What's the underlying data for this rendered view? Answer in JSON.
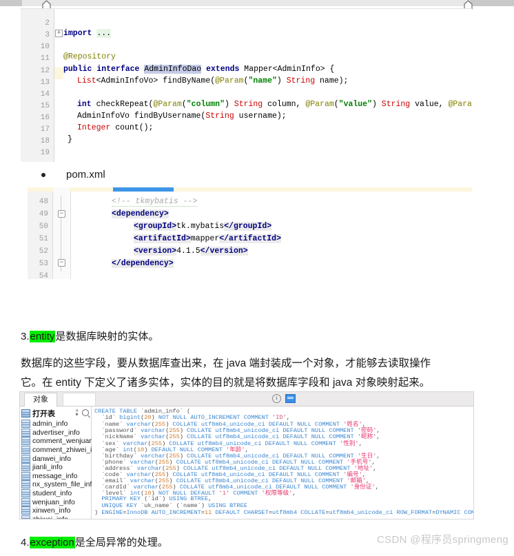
{
  "topbar": {
    "scroll_marker_icon": "home-marker-icon",
    "scroll_marker_icon_2": "home-marker-icon"
  },
  "java_code": {
    "line_numbers": [
      "2",
      "3",
      "10",
      "11",
      "12",
      "13",
      "14",
      "15",
      "16",
      "17",
      "18",
      "19"
    ],
    "lines": [
      "",
      "import ...",
      "",
      "@Repository",
      "public interface AdminInfoDao extends Mapper<AdminInfo> {",
      "    List<AdminInfoVo> findByName(@Param(\"name\") String name);",
      "",
      "    int checkRepeat(@Param(\"column\") String column, @Param(\"value\") String value, @Param(\"id\") Long id);",
      "    AdminInfoVo findByUsername(String username);",
      "    Integer count();",
      "}",
      ""
    ],
    "selected_token": "AdminInfoDao",
    "fold_icon": "fold-expand-icon"
  },
  "bullet": {
    "label": "pom.xml",
    "marker_icon": "bullet-dot-icon"
  },
  "pom_code": {
    "line_numbers": [
      "48",
      "49",
      "50",
      "51",
      "52",
      "53",
      "54"
    ],
    "lines": [
      "            <!-- tkmybatis -->",
      "            <dependency>",
      "                <groupId>tk.mybatis</groupId>",
      "                <artifactId>mapper</artifactId>",
      "                <version>4.1.5</version>",
      "            </dependency>",
      ""
    ],
    "comment_text": "<!-- tkmybatis -->",
    "groupId_value": "tk.mybatis",
    "artifactId_value": "mapper",
    "version_value": "4.1.5",
    "fold_icon_collapse": "fold-collapse-icon"
  },
  "paragraphs": {
    "heading3_prefix": "3.",
    "heading3_highlight": "entity",
    "heading3_rest": "是数据库映射的实体。",
    "body_line1": "数据库的这些字段，要从数据库查出来，在 java 端封装成一个对象，才能够去读取操作",
    "body_line2": "它。在 entity 下定义了诸多实体，实体的目的就是将数据库字段和 java 对象映射起来。",
    "heading4_prefix": "4.",
    "heading4_highlight": "exception",
    "heading4_rest": "是全局异常的处理。"
  },
  "db_panel": {
    "tab_label": "对象",
    "sidebar_title": "打开表",
    "sidebar_title_icon": "table-icon",
    "search_icon": "search-icon",
    "chevron_icon": "chevron-double-icon",
    "info_icon": "info-icon",
    "view_icon": "view-toggle-icon",
    "tables": [
      "admin_info",
      "advertiser_info",
      "comment_wenjuan_info",
      "comment_zhiwei_info",
      "danwei_info",
      "jianli_info",
      "message_info",
      "nx_system_file_info",
      "student_info",
      "wenjuan_info",
      "xinwen_info",
      "zhiwei_info"
    ],
    "sql_lines": [
      "CREATE TABLE `admin_info` (",
      "  `id` bigint(20) NOT NULL AUTO_INCREMENT COMMENT 'ID',",
      "  `name` varchar(255) COLLATE utf8mb4_unicode_ci DEFAULT NULL COMMENT '姓名',",
      "  `password` varchar(255) COLLATE utf8mb4_unicode_ci DEFAULT NULL COMMENT '密码',",
      "  `nickName` varchar(255) COLLATE utf8mb4_unicode_ci DEFAULT NULL COMMENT '昵称',",
      "  `sex` varchar(255) COLLATE utf8mb4_unicode_ci DEFAULT NULL COMMENT '性别',",
      "  `age` int(10) DEFAULT NULL COMMENT '年龄',",
      "  `birthday` varchar(255) COLLATE utf8mb4_unicode_ci DEFAULT NULL COMMENT '生日',",
      "  `phone` varchar(255) COLLATE utf8mb4_unicode_ci DEFAULT NULL COMMENT '手机号',",
      "  `address` varchar(255) COLLATE utf8mb4_unicode_ci DEFAULT NULL COMMENT '地址',",
      "  `code` varchar(255) COLLATE utf8mb4_unicode_ci DEFAULT NULL COMMENT '编号',",
      "  `email` varchar(255) COLLATE utf8mb4_unicode_ci DEFAULT NULL COMMENT '邮箱',",
      "  `cardId` varchar(255) COLLATE utf8mb4_unicode_ci DEFAULT NULL COMMENT '身份证',",
      "  `level` int(10) NOT NULL DEFAULT '1' COMMENT '权限等级',",
      "  PRIMARY KEY (`id`) USING BTREE,",
      "  UNIQUE KEY `uk_name` (`name`) USING BTREE",
      ") ENGINE=InnoDB AUTO_INCREMENT=11 DEFAULT CHARSET=utf8mb4 COLLATE=utf8mb4_unicode_ci ROW_FORMAT=DYNAMIC COMMENT='管理员信息表';"
    ]
  },
  "watermark": {
    "text": "CSDN @程序员springmeng"
  },
  "colors": {
    "highlight_green": "#00ee00",
    "accent_blue": "#3a8ee6",
    "code_keyword": "#000080",
    "code_type": "#cc0000",
    "code_string": "#008000",
    "code_annotation": "#808000",
    "sql_keyword": "#3a86d0",
    "sql_chinese": "#e8326a"
  }
}
